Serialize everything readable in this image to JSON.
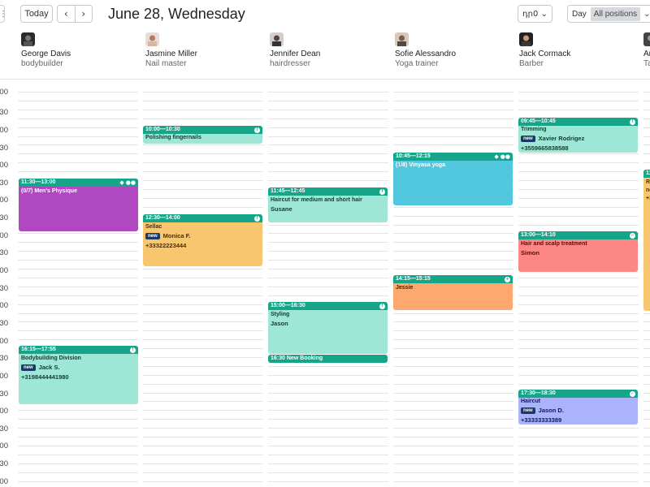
{
  "toolbar": {
    "menu_icon": "⋮",
    "today_label": "Today",
    "prev_icon": "‹",
    "next_icon": "›",
    "date_title": "June 28, Wednesday",
    "lang_label": "դր0",
    "lang_chevron": "⌄",
    "view_day": "Day",
    "view_positions": "All positions",
    "view_chevron": "⌄"
  },
  "colors": {
    "accent": "#17a589",
    "purple": "#b048c2",
    "orange_light": "#f7c66e",
    "teal_light": "#9ee6d5",
    "cyan": "#52c8de",
    "salmon": "#fda86e",
    "red": "#fc8784",
    "lavender": "#aab3fb"
  },
  "staff": [
    {
      "name": "George Davis",
      "role": "bodybuilder",
      "avatar": "avatar-george"
    },
    {
      "name": "Jasmine Miller",
      "role": "Nail master",
      "avatar": "avatar-jasmine"
    },
    {
      "name": "Jennifer Dean",
      "role": "hairdresser",
      "avatar": "avatar-jennifer"
    },
    {
      "name": "Sofie Alessandro",
      "role": "Yoga trainer",
      "avatar": "avatar-sofie"
    },
    {
      "name": "Jack Cormack",
      "role": "Barber",
      "avatar": "avatar-jack"
    },
    {
      "name": "An",
      "role": "Ta",
      "avatar": "avatar-partial"
    }
  ],
  "time_labels": [
    "00",
    "30",
    "00",
    "30",
    "00",
    "30",
    "00",
    "30",
    "00",
    "30",
    "00",
    "30",
    "00",
    "30",
    "00",
    "30",
    "00",
    "30",
    "00",
    "30",
    "00",
    "30",
    "00",
    "30"
  ],
  "events": {
    "george_mens_physique": {
      "time": "11:30—13:00",
      "title": "(0/7) Men's Physique",
      "icons": "tag-icon, group-icon"
    },
    "george_bodybuilding": {
      "time": "16:15—17:55",
      "title": "Bodybuilding Division",
      "badge": "new",
      "client": "Jack S.",
      "phone": "+3198444441980",
      "status_icon": "status-pending-icon"
    },
    "jasmine_polishing": {
      "time": "10:00—10:30",
      "title": "Polishing fingernails",
      "status_icon": "status-pending-icon"
    },
    "jasmine_sellac": {
      "time": "12:30—14:00",
      "title": "Sellac",
      "badge": "new",
      "client": "Monica F.",
      "phone": "+33322223444",
      "status_icon": "status-pending-icon"
    },
    "jennifer_haircut": {
      "time": "11:45—12:45",
      "title": "Haircut for medium and short hair",
      "client": "Susane",
      "status_icon": "status-pending-icon"
    },
    "jennifer_styling": {
      "time": "15:00—16:30",
      "title": "Styling",
      "client": "Jason",
      "status_icon": "status-pending-icon"
    },
    "jennifer_new_booking": {
      "label": "16:30 New Booking"
    },
    "sofie_vinyasa": {
      "time": "10:45—12:15",
      "title": "(1/8) Vinyasa yoga",
      "icons": "tag-icon, group-icon"
    },
    "sofie_jessie": {
      "time": "14:15—15:15",
      "client": "Jessie",
      "status_icon": "status-add-icon"
    },
    "jack_trimming": {
      "time": "09:45—10:45",
      "title": "Trimming",
      "badge": "new",
      "client": "Xavier Rodrigez",
      "phone": "+3559665838588",
      "status_icon": "status-pending-icon"
    },
    "jack_hair_scalp": {
      "time": "13:00—14:10",
      "title": "Hair and scalp treatment",
      "client": "Simon",
      "status_icon": "status-cancel-icon"
    },
    "jack_haircut": {
      "time": "17:30—18:30",
      "title": "Haircut",
      "badge": "new",
      "client": "Jason D.",
      "phone": "+33333333389",
      "status_icon": "status-done-icon"
    },
    "partial_event": {
      "time": "11",
      "title": "Re",
      "line2": "ne",
      "line3": "+3"
    }
  }
}
